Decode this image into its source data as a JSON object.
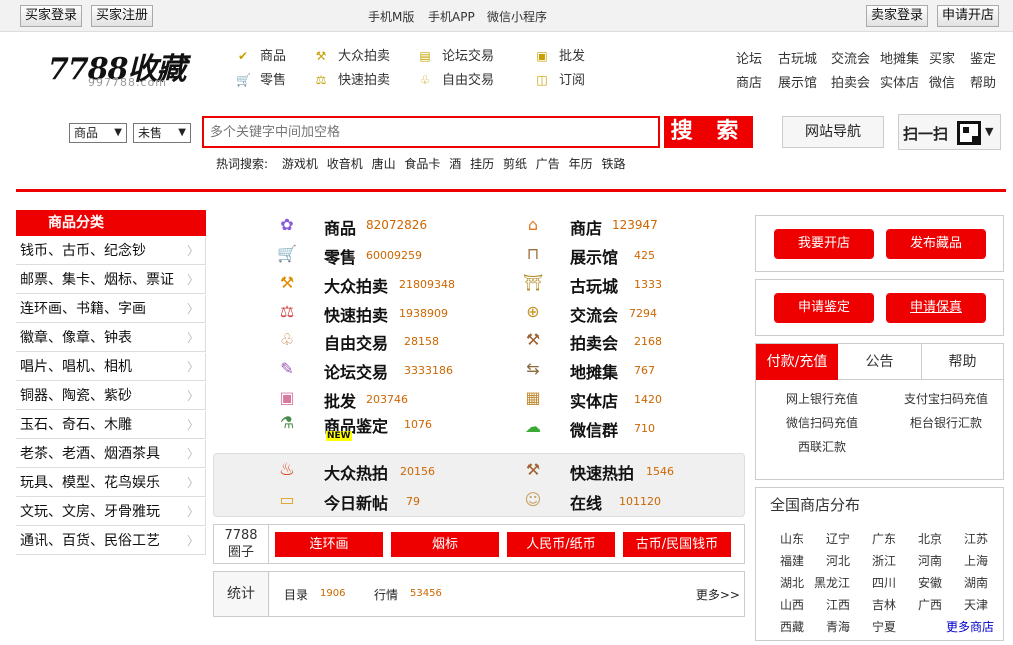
{
  "topbar": {
    "buyer_login": "买家登录",
    "buyer_register": "买家注册",
    "links": [
      "手机M版",
      "手机APP",
      "微信小程序"
    ],
    "seller_login": "卖家登录",
    "open_shop": "申请开店"
  },
  "logo": {
    "name": "7788收藏",
    "url": "997788.com"
  },
  "nav": [
    {
      "label": "商品",
      "icon": "check-icon"
    },
    {
      "label": "大众拍卖",
      "icon": "hammer-icon"
    },
    {
      "label": "论坛交易",
      "icon": "doc-icon"
    },
    {
      "label": "批发",
      "icon": "box-icon"
    },
    {
      "label": "零售",
      "icon": "cart-icon"
    },
    {
      "label": "快速拍卖",
      "icon": "gavel-icon"
    },
    {
      "label": "自由交易",
      "icon": "handshake-icon"
    },
    {
      "label": "订阅",
      "icon": "subscribe-icon"
    }
  ],
  "right_links": [
    [
      "论坛",
      "古玩城",
      "交流会",
      "地摊集",
      "买家",
      "鉴定"
    ],
    [
      "商店",
      "展示馆",
      "拍卖会",
      "实体店",
      "微信",
      "帮助"
    ]
  ],
  "search": {
    "type1": "商品",
    "type2": "未售",
    "placeholder": "多个关键字中间加空格",
    "button": "搜 索",
    "site_nav": "网站导航",
    "scan": "扫一扫",
    "hot_label": "热词搜索:",
    "hot_words": [
      "游戏机",
      "收音机",
      "唐山",
      "食品卡",
      "酒",
      "挂历",
      "剪纸",
      "广告",
      "年历",
      "铁路"
    ]
  },
  "categories": {
    "title": "商品分类",
    "items": [
      "钱币、古币、纪念钞",
      "邮票、集卡、烟标、票证",
      "连环画、书籍、字画",
      "徽章、像章、钟表",
      "唱片、唱机、相机",
      "铜器、陶瓷、紫砂",
      "玉石、奇石、木雕",
      "老茶、老酒、烟酒茶具",
      "玩具、模型、花鸟娱乐",
      "文玩、文房、牙骨雅玩",
      "通讯、百货、民俗工艺"
    ]
  },
  "stats_left": [
    {
      "label": "商品",
      "count": "82072826",
      "icon": "flower-icon"
    },
    {
      "label": "零售",
      "count": "60009259",
      "icon": "cart-icon"
    },
    {
      "label": "大众拍卖",
      "count": "21809348",
      "icon": "hammer-icon"
    },
    {
      "label": "快速拍卖",
      "count": "1938909",
      "icon": "gavel-icon"
    },
    {
      "label": "自由交易",
      "count": "28158",
      "icon": "handshake-icon"
    },
    {
      "label": "论坛交易",
      "count": "3333186",
      "icon": "notepad-icon"
    },
    {
      "label": "批发",
      "count": "203746",
      "icon": "box-icon"
    },
    {
      "label": "商品鉴定",
      "count": "1076",
      "icon": "microscope-icon",
      "badge": "NEW"
    }
  ],
  "stats_right": [
    {
      "label": "商店",
      "count": "123947",
      "icon": "store-icon"
    },
    {
      "label": "展示馆",
      "count": "425",
      "icon": "gallery-icon"
    },
    {
      "label": "古玩城",
      "count": "1333",
      "icon": "antique-icon"
    },
    {
      "label": "交流会",
      "count": "7294",
      "icon": "globe-icon"
    },
    {
      "label": "拍卖会",
      "count": "2168",
      "icon": "auction-icon"
    },
    {
      "label": "地摊集",
      "count": "767",
      "icon": "signpost-icon"
    },
    {
      "label": "实体店",
      "count": "1420",
      "icon": "shopfront-icon"
    },
    {
      "label": "微信群",
      "count": "710",
      "icon": "wechat-icon"
    }
  ],
  "hot_panel": [
    {
      "label": "大众热拍",
      "count": "20156",
      "icon": "fire-icon"
    },
    {
      "label": "快速热拍",
      "count": "1546",
      "icon": "gavel-icon"
    },
    {
      "label": "今日新帖",
      "count": "79",
      "icon": "note-icon"
    },
    {
      "label": "在线",
      "count": "101120",
      "icon": "people-icon"
    }
  ],
  "circle": {
    "label_line1": "7788",
    "label_line2": "圈子",
    "buttons": [
      "连环画",
      "烟标",
      "人民币/纸币",
      "古币/民国钱币"
    ]
  },
  "stats_row": {
    "label": "统计",
    "catalog_label": "目录",
    "catalog_count": "1906",
    "market_label": "行情",
    "market_count": "53456",
    "more": "更多>>"
  },
  "right_panel": {
    "open_shop": "我要开店",
    "publish": "发布藏品",
    "appraise": "申请鉴定",
    "insure": "申请保真",
    "tabs": [
      "付款/充值",
      "公告",
      "帮助"
    ],
    "payments": [
      "网上银行充值",
      "支付宝扫码充值",
      "微信扫码充值",
      "柜台银行汇款",
      "西联汇款"
    ],
    "shops_title": "全国商店分布",
    "provinces": [
      "山东",
      "辽宁",
      "广东",
      "北京",
      "江苏",
      "福建",
      "河北",
      "浙江",
      "河南",
      "上海",
      "湖北",
      "黑龙江",
      "四川",
      "安徽",
      "湖南",
      "山西",
      "江西",
      "吉林",
      "广西",
      "天津",
      "西藏",
      "青海",
      "宁夏"
    ],
    "more_shops": "更多商店"
  },
  "colors": {
    "accent": "#ee0000",
    "count": "#cc6600",
    "link_blue": "#0000cc"
  }
}
